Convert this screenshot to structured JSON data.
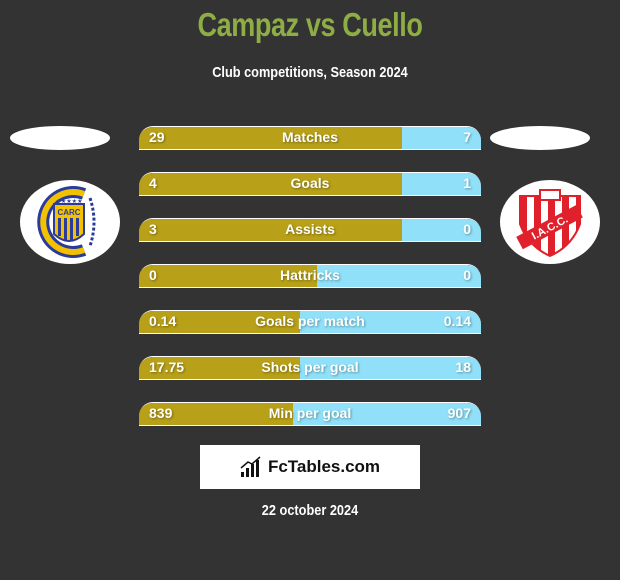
{
  "header": {
    "title": "Campaz vs Cuello",
    "subtitle": "Club competitions, Season 2024"
  },
  "colors": {
    "title": "#8fad45",
    "left_bar": "#b8a018",
    "right_bar": "#8fe0f8",
    "background": "#333333"
  },
  "teams": {
    "left": {
      "player": "Campaz",
      "logo_icon": "rosario-central-crest-icon",
      "logo_text": "CARC"
    },
    "right": {
      "player": "Cuello",
      "logo_icon": "instituto-crest-icon",
      "logo_text": "I.A.C.C."
    }
  },
  "stats": [
    {
      "label": "Matches",
      "left": "29",
      "right": "7",
      "left_share": 0.77
    },
    {
      "label": "Goals",
      "left": "4",
      "right": "1",
      "left_share": 0.77
    },
    {
      "label": "Assists",
      "left": "3",
      "right": "0",
      "left_share": 0.77
    },
    {
      "label": "Hattricks",
      "left": "0",
      "right": "0",
      "left_share": 0.52
    },
    {
      "label": "Goals per match",
      "left": "0.14",
      "right": "0.14",
      "left_share": 0.47
    },
    {
      "label": "Shots per goal",
      "left": "17.75",
      "right": "18",
      "left_share": 0.47
    },
    {
      "label": "Min per goal",
      "left": "839",
      "right": "907",
      "left_share": 0.45
    }
  ],
  "footer": {
    "brand": "FcTables.com",
    "brand_icon": "bar-chart-icon",
    "date": "22 october 2024"
  }
}
